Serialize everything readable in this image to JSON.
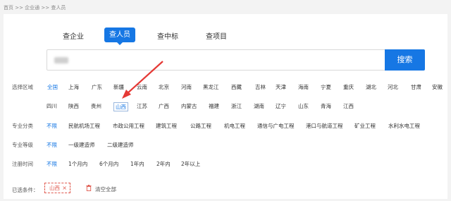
{
  "breadcrumb": "首页 >> 企业通 >> 查人员",
  "tabs": [
    "查企业",
    "查人员",
    "查中标",
    "查项目"
  ],
  "search": {
    "button": "搜索"
  },
  "filters": {
    "region_label": "选择区域",
    "regions_row1": [
      "全国",
      "上海",
      "广东",
      "新疆",
      "云南",
      "北京",
      "河南",
      "黑龙江",
      "西藏",
      "吉林",
      "天津",
      "海南",
      "宁夏",
      "重庆",
      "湖北",
      "河北",
      "甘肃",
      "安徽"
    ],
    "regions_row2": [
      "四川",
      "陕西",
      "贵州",
      "山西",
      "江苏",
      "广西",
      "内蒙古",
      "福建",
      "浙江",
      "湖南",
      "辽宁",
      "山东",
      "青海",
      "江西"
    ],
    "major_label": "专业分类",
    "majors": [
      "不限",
      "民航机场工程",
      "市政公用工程",
      "建筑工程",
      "公路工程",
      "机电工程",
      "通信与广电工程",
      "港口与航道工程",
      "矿业工程",
      "水利水电工程"
    ],
    "level_label": "专业等级",
    "levels": [
      "不限",
      "一级建造师",
      "二级建造师"
    ],
    "time_label": "注册时间",
    "times": [
      "不限",
      "1个月内",
      "6个月内",
      "1年内",
      "2年内",
      "2年以上"
    ]
  },
  "selected": {
    "label": "已选条件：",
    "tag": "山西",
    "tag_close": "×",
    "clear": "清空全部"
  },
  "colors": {
    "accent": "#1677e4",
    "annotation": "#e53935",
    "tag": "#e05a4f"
  },
  "icons": {
    "trash": "trash-icon",
    "close": "close-icon"
  }
}
